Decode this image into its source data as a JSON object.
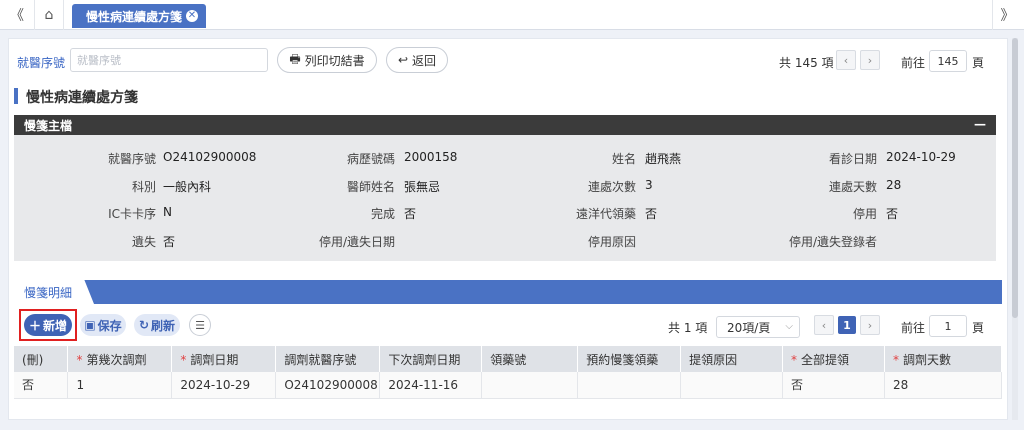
{
  "topbar": {
    "collapse_icon": "double-chevron-left",
    "home_icon": "home",
    "active_tab": "慢性病連續處方箋",
    "expand_icon": "double-chevron-right"
  },
  "search": {
    "label": "就醫序號",
    "placeholder": "就醫序號",
    "print_label": "列印切結書",
    "back_label": "返回",
    "total_text": "共 145 項",
    "goto_label": "前往",
    "goto_value": "145",
    "page_unit": "頁"
  },
  "page_title": "慢性病連續處方箋",
  "master": {
    "header": "慢箋主檔",
    "collapse_symbol": "—",
    "fields": [
      {
        "label": "就醫序號",
        "value": "O24102900008"
      },
      {
        "label": "病歷號碼",
        "value": "2000158"
      },
      {
        "label": "姓名",
        "value": "趙飛燕"
      },
      {
        "label": "看診日期",
        "value": "2024-10-29"
      },
      {
        "label": "科別",
        "value": "一般內科"
      },
      {
        "label": "醫師姓名",
        "value": "張無忌"
      },
      {
        "label": "連處次數",
        "value": "3"
      },
      {
        "label": "連處天數",
        "value": "28"
      },
      {
        "label": "IC卡卡序",
        "value": "N"
      },
      {
        "label": "完成",
        "value": "否"
      },
      {
        "label": "遠洋代領藥",
        "value": "否"
      },
      {
        "label": "停用",
        "value": "否"
      },
      {
        "label": "遺失",
        "value": "否"
      },
      {
        "label": "停用/遺失日期",
        "value": ""
      },
      {
        "label": "停用原因",
        "value": ""
      },
      {
        "label": "停用/遺失登錄者",
        "value": ""
      }
    ]
  },
  "detail": {
    "tab_label": "慢箋明細",
    "add_label": "新增",
    "save_label": "保存",
    "refresh_label": "刷新",
    "total_text": "共 1 項",
    "page_size": "20項/頁",
    "current_page": "1",
    "goto_label": "前往",
    "goto_value": "1",
    "page_unit": "頁",
    "columns": [
      "(刪)",
      "第幾次調劑",
      "調劑日期",
      "調劑就醫序號",
      "下次調劑日期",
      "領藥號",
      "預約慢箋領藥",
      "提領原因",
      "全部提領",
      "調劑天數"
    ],
    "required_columns": [
      1,
      2,
      8,
      9
    ],
    "rows": [
      [
        "否",
        "1",
        "2024-10-29",
        "O24102900008",
        "2024-11-16",
        "",
        "",
        "",
        "否",
        "28"
      ]
    ]
  }
}
